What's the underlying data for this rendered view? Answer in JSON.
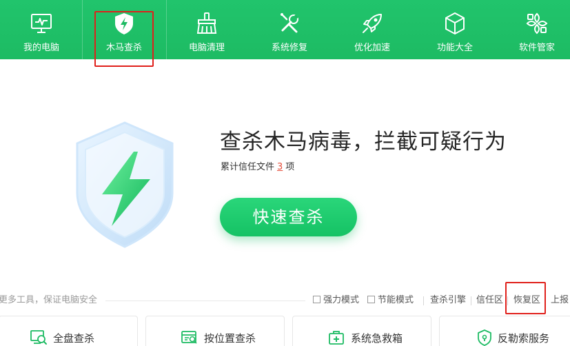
{
  "nav": {
    "items": [
      {
        "label": "我的电脑",
        "icon": "monitor-icon"
      },
      {
        "label": "木马查杀",
        "icon": "shield-bolt-icon",
        "active": true
      },
      {
        "label": "电脑清理",
        "icon": "broom-icon"
      },
      {
        "label": "系统修复",
        "icon": "tools-icon"
      },
      {
        "label": "优化加速",
        "icon": "rocket-icon"
      },
      {
        "label": "功能大全",
        "icon": "cube-icon"
      },
      {
        "label": "软件管家",
        "icon": "apps-icon"
      }
    ]
  },
  "hero": {
    "title": "查杀木马病毒，拦截可疑行为",
    "trusted_prefix": "累计信任文件",
    "trusted_count": "3",
    "trusted_suffix": "项",
    "scan_button": "快速查杀"
  },
  "tools": {
    "title": "更多工具，保证电脑安全",
    "options": {
      "power_mode": "强力模式",
      "save_mode": "节能模式"
    },
    "links": {
      "engine": "查杀引擎",
      "trust_zone": "信任区",
      "restore_zone": "恢复区",
      "report": "上报"
    }
  },
  "cards": [
    {
      "label": "全盘查杀",
      "icon": "full-scan-icon"
    },
    {
      "label": "按位置查杀",
      "icon": "location-scan-icon"
    },
    {
      "label": "系统急救箱",
      "icon": "first-aid-icon"
    },
    {
      "label": "反勒索服务",
      "icon": "anti-ransom-icon"
    }
  ],
  "colors": {
    "nav_bg": "#1fbf66",
    "accent": "#1dc467",
    "highlight": "#e0201b",
    "count": "#e44d3a"
  }
}
